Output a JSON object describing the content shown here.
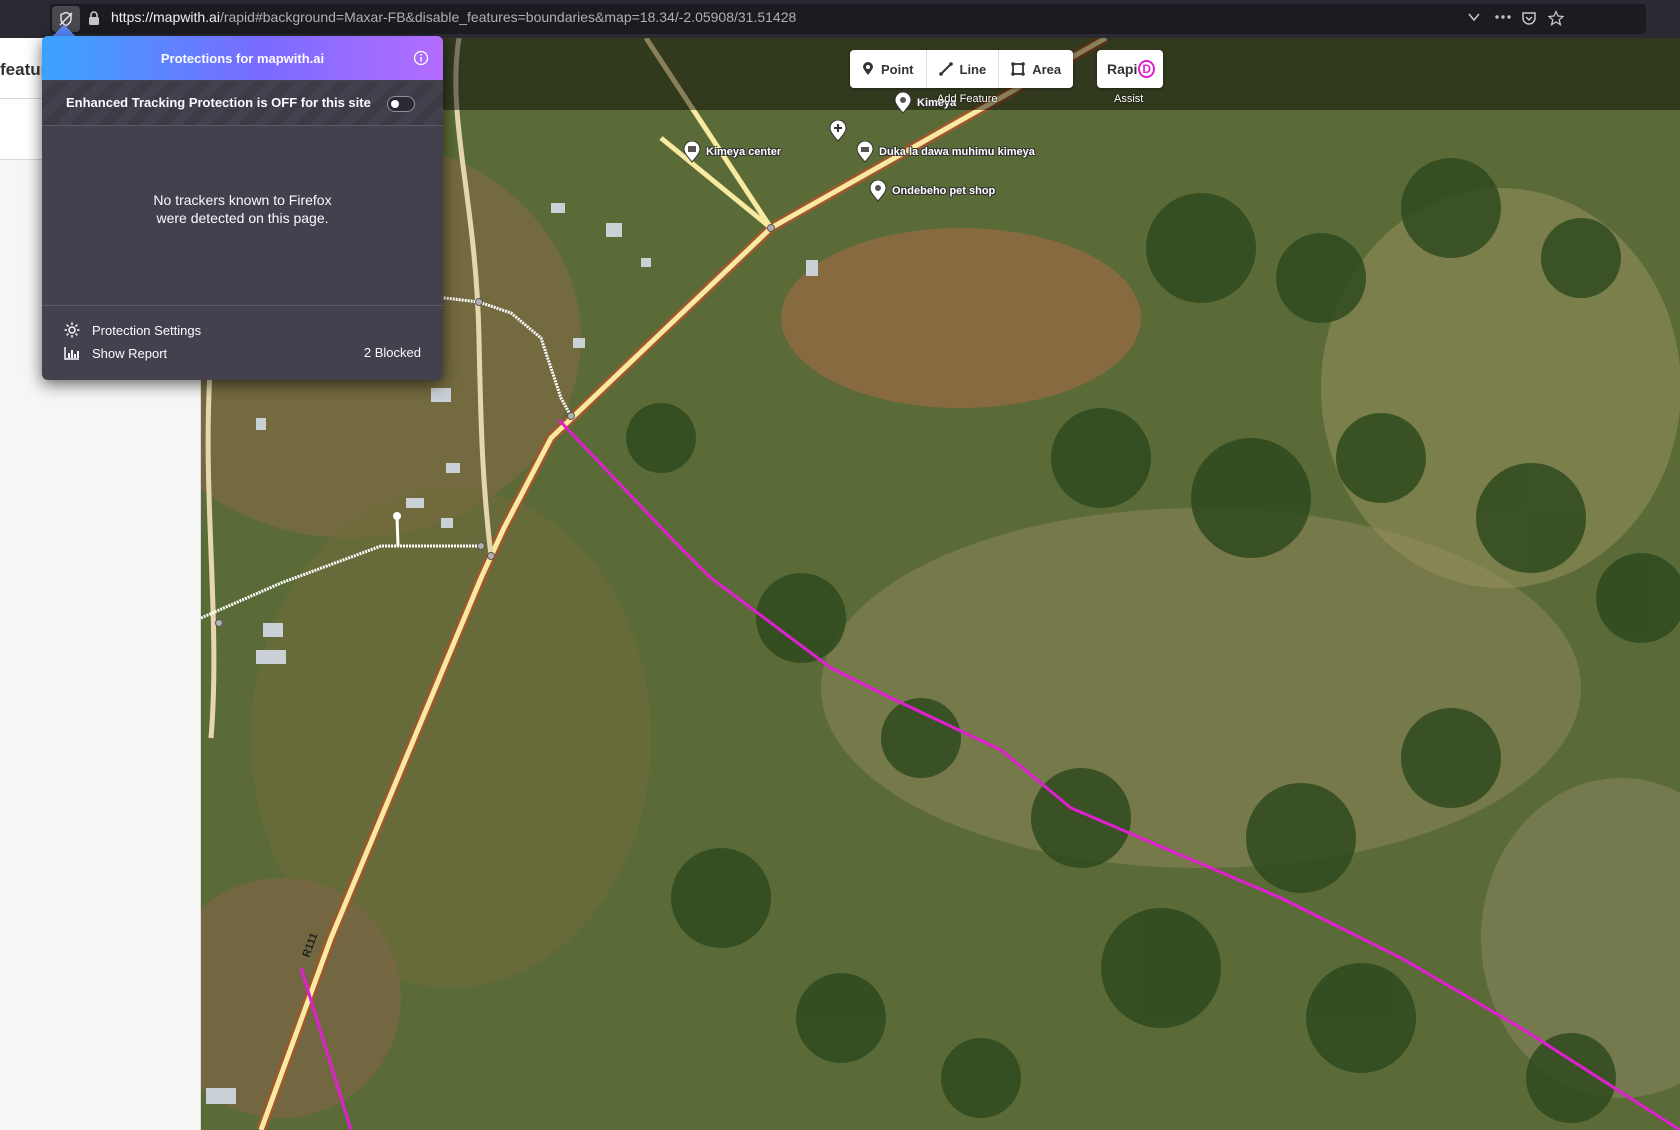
{
  "browser": {
    "url_host": "https://mapwith.ai",
    "url_rest": "/rapid#background=Maxar-FB&disable_features=boundaries&map=18.34/-2.05908/31.51428"
  },
  "sidebar": {
    "title_fragment": "featur"
  },
  "toolbar": {
    "point_label": "Point",
    "line_label": "Line",
    "area_label": "Area",
    "add_feature_label": "Add Feature",
    "rapid_label": "Rapi",
    "rapid_d": "D",
    "assist_label": "Assist"
  },
  "map": {
    "pois": [
      {
        "name": "Kimeya"
      },
      {
        "name": "Kimeya center"
      },
      {
        "name": "Duka la dawa muhimu kimeya"
      },
      {
        "name": "Ondebeho pet shop"
      }
    ],
    "road_ref": "R111",
    "colors": {
      "road": "#f8eaa0",
      "path": "#ffffff",
      "boundary": "#e020d0",
      "vegetation": "#4a6b2e"
    }
  },
  "protections_panel": {
    "title": "Protections for mapwith.ai",
    "etp_text": "Enhanced Tracking Protection is OFF for this site",
    "etp_on": false,
    "no_trackers_line1": "No trackers known to Firefox",
    "no_trackers_line2": "were detected on this page.",
    "settings_label": "Protection Settings",
    "report_label": "Show Report",
    "blocked_count": "2 Blocked"
  }
}
